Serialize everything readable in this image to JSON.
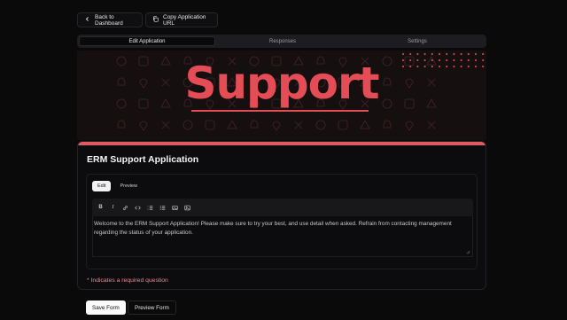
{
  "header": {
    "back_label": "Back to Dashboard",
    "copy_label": "Copy Application URL"
  },
  "tabs": [
    {
      "label": "Edit Application",
      "active": true
    },
    {
      "label": "Responses",
      "active": false
    },
    {
      "label": "Settings",
      "active": false
    }
  ],
  "banner": {
    "text": "Support",
    "accent_color": "#e44d56"
  },
  "form": {
    "title": "ERM Support Application",
    "mode_tabs": [
      "Edit",
      "Preview"
    ],
    "toolbar": {
      "bold": "B",
      "italic": "I",
      "icons": [
        "link-icon",
        "code-icon",
        "ordered-list-icon",
        "bullet-list-icon",
        "image-icon",
        "embed-icon"
      ]
    },
    "description": "Welcome to the ERM Support Application! Please make sure to try your best, and use detail when asked. Refrain from contacting management regarding the status of your application.",
    "required_note": "* Indicates a required question"
  },
  "actions": {
    "save_label": "Save Form",
    "preview_label": "Preview Form"
  }
}
